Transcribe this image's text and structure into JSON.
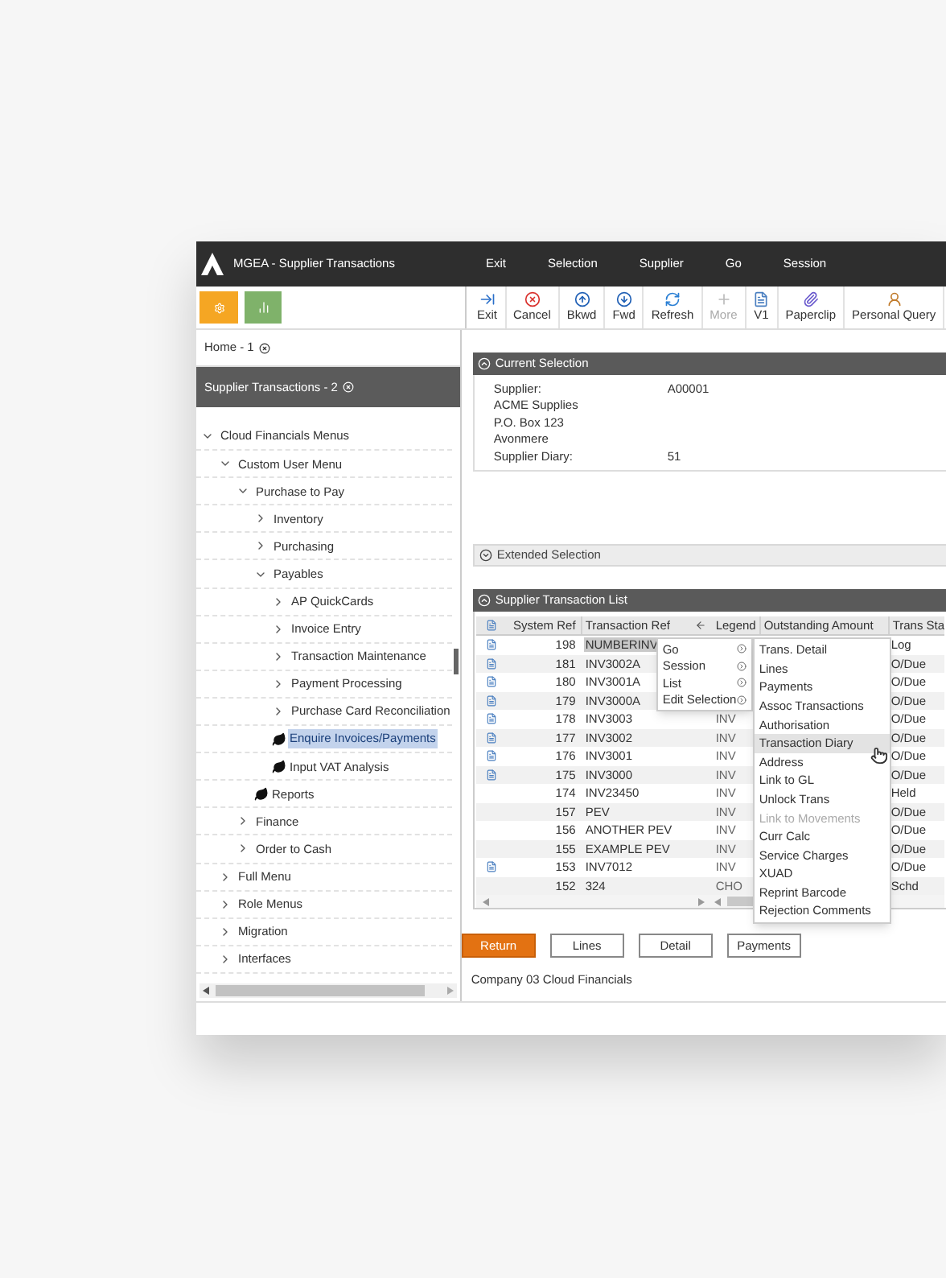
{
  "window": {
    "title": "MGEA - Supplier Transactions"
  },
  "menu_bar": [
    "Exit",
    "Selection",
    "Supplier",
    "Go",
    "Session"
  ],
  "toolbar": [
    {
      "label": "Exit",
      "kind": "exit",
      "disabled": false
    },
    {
      "label": "Cancel",
      "kind": "cancel",
      "disabled": false
    },
    {
      "label": "Bkwd",
      "kind": "up",
      "disabled": false
    },
    {
      "label": "Fwd",
      "kind": "down",
      "disabled": false
    },
    {
      "label": "Refresh",
      "kind": "refresh",
      "disabled": false
    },
    {
      "label": "More",
      "kind": "plus",
      "disabled": true
    },
    {
      "label": "V1",
      "kind": "document",
      "disabled": false
    },
    {
      "label": "Paperclip",
      "kind": "paperclip",
      "disabled": false
    },
    {
      "label": "Personal Query",
      "kind": "person",
      "disabled": false
    }
  ],
  "open_tabs": [
    {
      "label": "Home - 1",
      "selected": false
    },
    {
      "label": "Supplier Transactions - 2",
      "selected": true
    }
  ],
  "menu_tree": [
    {
      "label": "Cloud Financials Menus",
      "kind": "folder",
      "expanded": true,
      "children": [
        {
          "label": "Custom User Menu",
          "kind": "folder",
          "expanded": true,
          "children": [
            {
              "label": "Purchase to Pay",
              "kind": "folder",
              "expanded": true,
              "children": [
                {
                  "label": "Inventory",
                  "kind": "folder",
                  "expanded": false
                },
                {
                  "label": "Purchasing",
                  "kind": "folder",
                  "expanded": false
                },
                {
                  "label": "Payables",
                  "kind": "folder",
                  "expanded": true,
                  "children": [
                    {
                      "label": "AP QuickCards",
                      "kind": "folder",
                      "expanded": false
                    },
                    {
                      "label": "Invoice Entry",
                      "kind": "folder",
                      "expanded": false
                    },
                    {
                      "label": "Transaction Maintenance",
                      "kind": "folder",
                      "expanded": false
                    },
                    {
                      "label": "Payment Processing",
                      "kind": "folder",
                      "expanded": false
                    },
                    {
                      "label": "Purchase Card Reconciliation",
                      "kind": "folder",
                      "expanded": false
                    },
                    {
                      "label": "Enquire Invoices/Payments",
                      "kind": "leaf",
                      "selected": true
                    },
                    {
                      "label": "Input VAT Analysis",
                      "kind": "leaf",
                      "selected": false
                    }
                  ]
                },
                {
                  "label": "Reports",
                  "kind": "leaf",
                  "selected": false
                }
              ]
            },
            {
              "label": "Finance",
              "kind": "folder",
              "expanded": false
            },
            {
              "label": "Order to Cash",
              "kind": "folder",
              "expanded": false
            }
          ]
        },
        {
          "label": "Full Menu",
          "kind": "folder",
          "expanded": false
        },
        {
          "label": "Role Menus",
          "kind": "folder",
          "expanded": false
        },
        {
          "label": "Migration",
          "kind": "folder",
          "expanded": false
        },
        {
          "label": "Interfaces",
          "kind": "folder",
          "expanded": false
        }
      ]
    }
  ],
  "current_selection": {
    "title": "Current Selection",
    "expanded": true,
    "fields": [
      {
        "label": "Supplier:",
        "value": "A00001"
      },
      {
        "label": "ACME Supplies"
      },
      {
        "label": "P.O. Box 123"
      },
      {
        "label": "Avonmere"
      },
      {
        "label": "Supplier Diary:",
        "value": "51"
      }
    ]
  },
  "extended_selection": {
    "title": "Extended Selection",
    "expanded": false
  },
  "transaction_list": {
    "title": "Supplier Transaction List",
    "expanded": true,
    "columns": [
      "System Ref",
      "Transaction Ref",
      "Legend",
      "Outstanding Amount",
      "Trans Sta"
    ],
    "rows": [
      {
        "has_icon": true,
        "selected": true,
        "system_ref": "198",
        "transaction_ref": "NUMBERINV",
        "trans_status": "Log"
      },
      {
        "has_icon": true,
        "selected": false,
        "system_ref": "181",
        "transaction_ref": "INV3002A",
        "trans_status": "O/Due"
      },
      {
        "has_icon": true,
        "selected": false,
        "system_ref": "180",
        "transaction_ref": "INV3001A",
        "trans_status": "O/Due"
      },
      {
        "has_icon": true,
        "selected": false,
        "system_ref": "179",
        "transaction_ref": "INV3000A",
        "trans_status": "O/Due"
      },
      {
        "has_icon": true,
        "selected": false,
        "system_ref": "178",
        "transaction_ref": "INV3003",
        "legend": "INV",
        "trans_status": "O/Due"
      },
      {
        "has_icon": true,
        "selected": false,
        "system_ref": "177",
        "transaction_ref": "INV3002",
        "legend": "INV",
        "trans_status": "O/Due"
      },
      {
        "has_icon": true,
        "selected": false,
        "system_ref": "176",
        "transaction_ref": "INV3001",
        "legend": "INV",
        "trans_status": "O/Due"
      },
      {
        "has_icon": true,
        "selected": false,
        "system_ref": "175",
        "transaction_ref": "INV3000",
        "legend": "INV",
        "trans_status": "O/Due"
      },
      {
        "has_icon": false,
        "selected": false,
        "system_ref": "174",
        "transaction_ref": "INV23450",
        "legend": "INV",
        "trans_status": "Held"
      },
      {
        "has_icon": false,
        "selected": false,
        "system_ref": "157",
        "transaction_ref": "PEV",
        "legend": "INV",
        "trans_status": "O/Due"
      },
      {
        "has_icon": false,
        "selected": false,
        "system_ref": "156",
        "transaction_ref": "ANOTHER PEV",
        "legend": "INV",
        "trans_status": "O/Due"
      },
      {
        "has_icon": false,
        "selected": false,
        "system_ref": "155",
        "transaction_ref": "EXAMPLE PEV",
        "legend": "INV",
        "trans_status": "O/Due"
      },
      {
        "has_icon": true,
        "selected": false,
        "system_ref": "153",
        "transaction_ref": "INV7012",
        "legend": "INV",
        "trans_status": "O/Due"
      },
      {
        "has_icon": false,
        "selected": false,
        "system_ref": "152",
        "transaction_ref": "324",
        "legend": "CHO",
        "trans_status": "Schd"
      }
    ]
  },
  "context_menu": [
    {
      "label": "Go"
    },
    {
      "label": "Session"
    },
    {
      "label": "List"
    },
    {
      "label": "Edit Selection"
    }
  ],
  "submenu": [
    {
      "label": "Trans. Detail",
      "hovered": false,
      "disabled": false
    },
    {
      "label": "Lines",
      "hovered": false,
      "disabled": false
    },
    {
      "label": "Payments",
      "hovered": false,
      "disabled": false
    },
    {
      "label": "Assoc Transactions",
      "hovered": false,
      "disabled": false
    },
    {
      "label": "Authorisation",
      "hovered": false,
      "disabled": false
    },
    {
      "label": "Transaction Diary",
      "hovered": true,
      "disabled": false
    },
    {
      "label": "Address",
      "hovered": false,
      "disabled": false
    },
    {
      "label": "Link to GL",
      "hovered": false,
      "disabled": false
    },
    {
      "label": "Unlock Trans",
      "hovered": false,
      "disabled": false
    },
    {
      "label": "Link to Movements",
      "hovered": false,
      "disabled": true
    },
    {
      "label": "Curr Calc",
      "hovered": false,
      "disabled": false
    },
    {
      "label": "Service Charges",
      "hovered": false,
      "disabled": false
    },
    {
      "label": "XUAD",
      "hovered": false,
      "disabled": false
    },
    {
      "label": "Reprint Barcode",
      "hovered": false,
      "disabled": false
    },
    {
      "label": "Rejection Comments",
      "hovered": false,
      "disabled": false
    }
  ],
  "buttons": [
    {
      "label": "Return",
      "primary": true
    },
    {
      "label": "Lines",
      "primary": false
    },
    {
      "label": "Detail",
      "primary": false
    },
    {
      "label": "Payments",
      "primary": false
    }
  ],
  "status_bar": "Company 03 Cloud Financials"
}
